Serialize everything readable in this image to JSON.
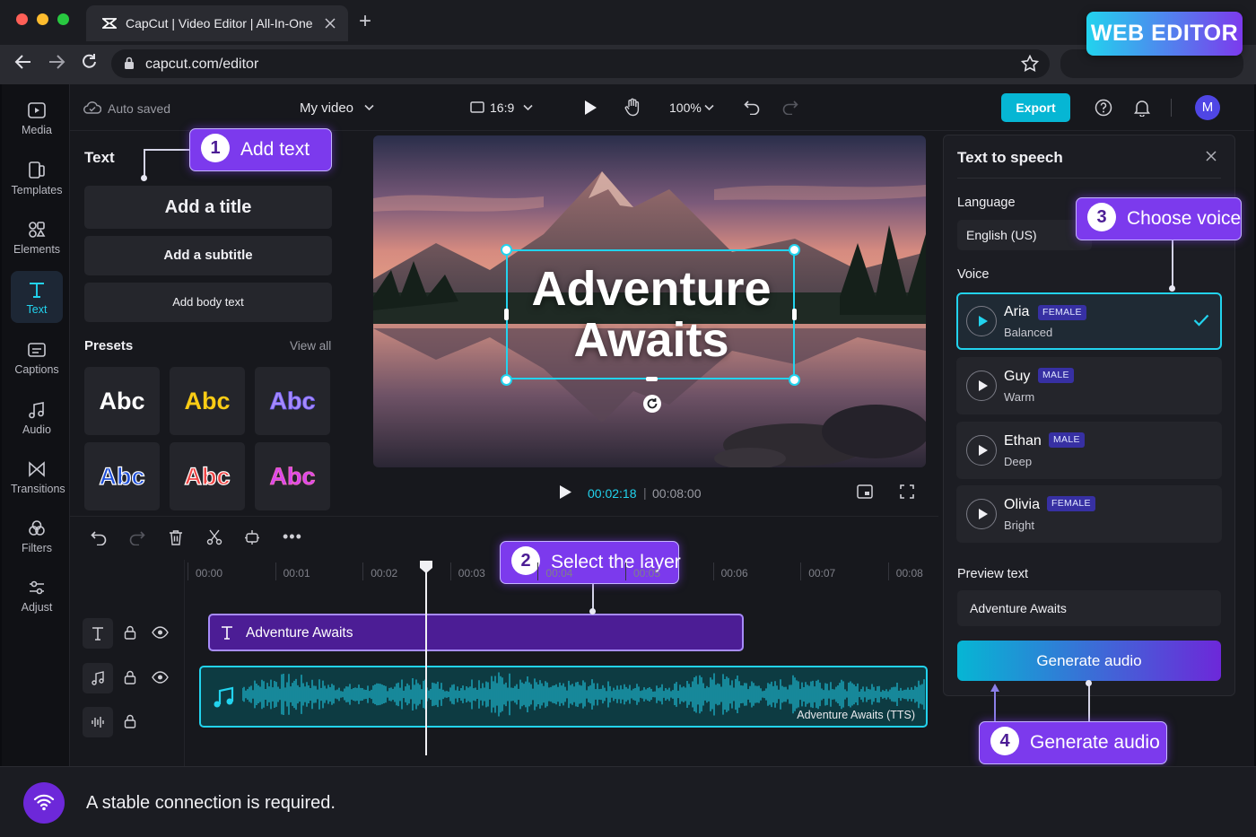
{
  "browser": {
    "tab_title": "CapCut | Video Editor | All-In-One",
    "url": "capcut.com/editor",
    "new_tab": "+"
  },
  "banner": "WEB EDITOR",
  "nav": [
    {
      "label": "Media",
      "icon": "media-icon"
    },
    {
      "label": "Templates",
      "icon": "templates-icon"
    },
    {
      "label": "Elements",
      "icon": "elements-icon"
    },
    {
      "label": "Text",
      "icon": "text-icon",
      "active": true
    },
    {
      "label": "Captions",
      "icon": "captions-icon"
    },
    {
      "label": "Audio",
      "icon": "audio-icon"
    },
    {
      "label": "Transitions",
      "icon": "transitions-icon"
    },
    {
      "label": "Filters",
      "icon": "filters-icon"
    },
    {
      "label": "Adjust",
      "icon": "adjust-icon"
    }
  ],
  "topbar": {
    "autosave": "Auto saved",
    "project": "My video",
    "ratio": "16:9",
    "zoom": "100%",
    "export": "Export",
    "avatar": "M"
  },
  "text_panel": {
    "heading": "Text",
    "add_title": "Add a title",
    "add_subtitle": "Add a subtitle",
    "add_body": "Add body text",
    "presets_label": "Presets",
    "view_all": "View all",
    "preset_text": "Abc"
  },
  "preview": {
    "overlay_line1": "Adventure",
    "overlay_line2": "Awaits",
    "current_time": "00:02:18",
    "total_time": "00:08:00",
    "separator": "|"
  },
  "timeline": {
    "ticks": [
      "00:00",
      "00:01",
      "00:02",
      "00:03",
      "00:04",
      "00:05",
      "00:06",
      "00:07",
      "00:08"
    ],
    "text_clip": "Adventure Awaits",
    "audio_clip": "Adventure Awaits (TTS)"
  },
  "tts": {
    "title": "Text to speech",
    "language_label": "Language",
    "language_value": "English (US)",
    "voice_label": "Voice",
    "voices": [
      {
        "name": "Aria",
        "gender": "FEMALE",
        "style": "Balanced",
        "selected": true
      },
      {
        "name": "Guy",
        "gender": "MALE",
        "style": "Warm"
      },
      {
        "name": "Ethan",
        "gender": "MALE",
        "style": "Deep"
      },
      {
        "name": "Olivia",
        "gender": "FEMALE",
        "style": "Bright"
      }
    ],
    "preview_label": "Preview text",
    "preview_value": "Adventure Awaits",
    "generate": "Generate audio"
  },
  "callouts": [
    {
      "num": "1",
      "label": "Add text"
    },
    {
      "num": "2",
      "label": "Select the layer"
    },
    {
      "num": "3",
      "label": "Choose voice"
    },
    {
      "num": "4",
      "label": "Generate audio"
    }
  ],
  "footer": {
    "message": "A stable connection is required."
  },
  "colors": {
    "accent": "#22d3ee",
    "purple": "#7c3aed",
    "clip_text": "#4c1d95",
    "clip_audio": "#0d3b42"
  }
}
